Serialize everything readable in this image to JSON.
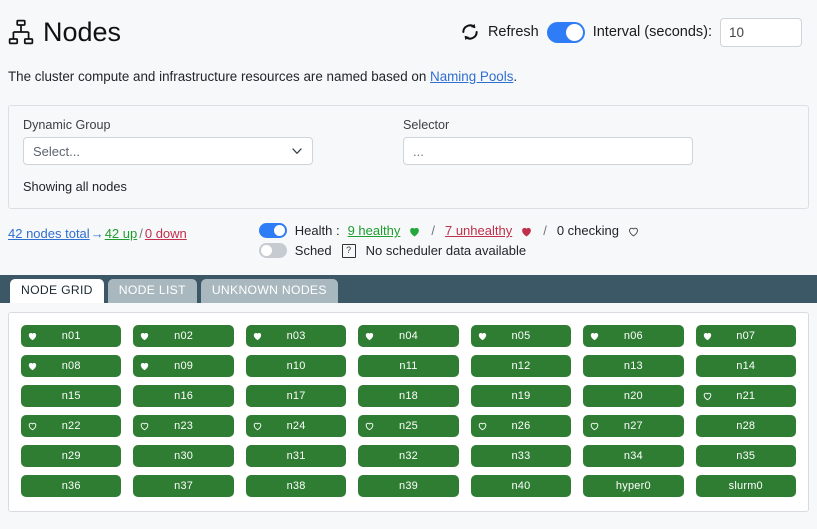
{
  "header": {
    "icon": "sitemap-icon",
    "title": "Nodes",
    "refresh": {
      "icon": "refresh-icon",
      "label": "Refresh",
      "toggle_on": true,
      "interval_label": "Interval (seconds):",
      "interval_value": "10"
    }
  },
  "description": {
    "text_before": "The cluster compute and infrastructure resources are named based on ",
    "link_text": "Naming Pools",
    "text_after": "."
  },
  "filters": {
    "dynamic_group": {
      "label": "Dynamic Group",
      "value": "Select...",
      "icon": "chevron-down-icon"
    },
    "selector": {
      "label": "Selector",
      "value": "",
      "placeholder": "..."
    },
    "showing": "Showing all nodes"
  },
  "stats": {
    "total": "42 nodes total",
    "arrow": "→",
    "up": "42 up",
    "separator": "/",
    "down": "0 down"
  },
  "health": {
    "toggle_on": true,
    "label": "Health :",
    "healthy": "9 healthy",
    "healthy_icon": "heart-filled-green-icon",
    "sep1": "/",
    "unhealthy": "7 unhealthy",
    "unhealthy_icon": "heart-filled-red-icon",
    "sep2": "/",
    "checking": "0 checking",
    "checking_icon": "heart-outline-icon"
  },
  "scheduler": {
    "toggle_on": false,
    "label": "Sched",
    "help_icon": "question-box-icon",
    "message": "No scheduler data available"
  },
  "tabs": [
    {
      "label": "NODE GRID",
      "active": true
    },
    {
      "label": "NODE LIST",
      "active": false
    },
    {
      "label": "UNKNOWN NODES",
      "active": false
    }
  ],
  "colors": {
    "node_tile_green": "#2e7d32",
    "tabbar_slate": "#3c5765",
    "toggle_blue": "#2f7df6",
    "link_blue": "#2f6fd0",
    "up_green": "#1f9d2f",
    "down_red": "#c0304a"
  },
  "nodes": [
    {
      "label": "n01",
      "heart": "filled"
    },
    {
      "label": "n02",
      "heart": "filled"
    },
    {
      "label": "n03",
      "heart": "filled"
    },
    {
      "label": "n04",
      "heart": "filled"
    },
    {
      "label": "n05",
      "heart": "filled"
    },
    {
      "label": "n06",
      "heart": "filled"
    },
    {
      "label": "n07",
      "heart": "filled"
    },
    {
      "label": "n08",
      "heart": "filled"
    },
    {
      "label": "n09",
      "heart": "filled"
    },
    {
      "label": "n10",
      "heart": "none"
    },
    {
      "label": "n11",
      "heart": "none"
    },
    {
      "label": "n12",
      "heart": "none"
    },
    {
      "label": "n13",
      "heart": "none"
    },
    {
      "label": "n14",
      "heart": "none"
    },
    {
      "label": "n15",
      "heart": "none"
    },
    {
      "label": "n16",
      "heart": "none"
    },
    {
      "label": "n17",
      "heart": "none"
    },
    {
      "label": "n18",
      "heart": "none"
    },
    {
      "label": "n19",
      "heart": "none"
    },
    {
      "label": "n20",
      "heart": "none"
    },
    {
      "label": "n21",
      "heart": "outline"
    },
    {
      "label": "n22",
      "heart": "outline"
    },
    {
      "label": "n23",
      "heart": "outline"
    },
    {
      "label": "n24",
      "heart": "outline"
    },
    {
      "label": "n25",
      "heart": "outline"
    },
    {
      "label": "n26",
      "heart": "outline"
    },
    {
      "label": "n27",
      "heart": "outline"
    },
    {
      "label": "n28",
      "heart": "none"
    },
    {
      "label": "n29",
      "heart": "none"
    },
    {
      "label": "n30",
      "heart": "none"
    },
    {
      "label": "n31",
      "heart": "none"
    },
    {
      "label": "n32",
      "heart": "none"
    },
    {
      "label": "n33",
      "heart": "none"
    },
    {
      "label": "n34",
      "heart": "none"
    },
    {
      "label": "n35",
      "heart": "none"
    },
    {
      "label": "n36",
      "heart": "none"
    },
    {
      "label": "n37",
      "heart": "none"
    },
    {
      "label": "n38",
      "heart": "none"
    },
    {
      "label": "n39",
      "heart": "none"
    },
    {
      "label": "n40",
      "heart": "none"
    },
    {
      "label": "hyper0",
      "heart": "none"
    },
    {
      "label": "slurm0",
      "heart": "none"
    }
  ]
}
